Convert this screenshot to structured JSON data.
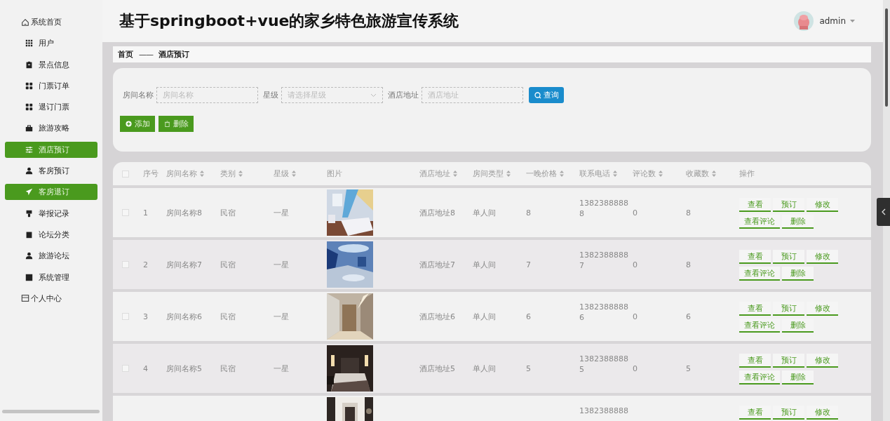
{
  "sidebar": {
    "items": [
      {
        "label": "系统首页",
        "kind": "top",
        "selected": false
      },
      {
        "label": "用户",
        "kind": "sub",
        "selected": false
      },
      {
        "label": "景点信息",
        "kind": "sub",
        "selected": false
      },
      {
        "label": "门票订单",
        "kind": "sub",
        "selected": false
      },
      {
        "label": "退订门票",
        "kind": "sub",
        "selected": false
      },
      {
        "label": "旅游攻略",
        "kind": "sub",
        "selected": false
      },
      {
        "label": "酒店预订",
        "kind": "sub",
        "selected": true
      },
      {
        "label": "客房预订",
        "kind": "sub",
        "selected": false
      },
      {
        "label": "客房退订",
        "kind": "sub",
        "selected": true
      },
      {
        "label": "举报记录",
        "kind": "sub",
        "selected": false
      },
      {
        "label": "论坛分类",
        "kind": "sub",
        "selected": false
      },
      {
        "label": "旅游论坛",
        "kind": "sub",
        "selected": false
      },
      {
        "label": "系统管理",
        "kind": "sub",
        "selected": false
      },
      {
        "label": "个人中心",
        "kind": "top",
        "selected": false
      }
    ]
  },
  "header": {
    "title": "基于springboot+vue的家乡特色旅游宣传系统",
    "user": "admin"
  },
  "breadcrumb": [
    "首页",
    "——",
    "酒店预订"
  ],
  "search": {
    "fields": [
      {
        "label": "房间名称",
        "placeholder": "房间名称",
        "kind": "input"
      },
      {
        "label": "星级",
        "placeholder": "请选择星级",
        "kind": "select"
      },
      {
        "label": "酒店地址",
        "placeholder": "酒店地址",
        "kind": "input"
      }
    ],
    "button": "查询"
  },
  "actions": [
    {
      "label": "添加",
      "kind": "add"
    },
    {
      "label": "删除",
      "kind": "delete"
    }
  ],
  "table": {
    "select_all": {
      "checked": false
    },
    "columns": [
      {
        "label": "序号",
        "sortable": false
      },
      {
        "label": "房间名称",
        "sortable": true
      },
      {
        "label": "类别",
        "sortable": true
      },
      {
        "label": "星级",
        "sortable": true
      },
      {
        "label": "图片",
        "sortable": false
      },
      {
        "label": "酒店地址",
        "sortable": true
      },
      {
        "label": "房间类型",
        "sortable": true
      },
      {
        "label": "一晚价格",
        "sortable": true
      },
      {
        "label": "联系电话",
        "sortable": true
      },
      {
        "label": "评论数",
        "sortable": true
      },
      {
        "label": "收藏数",
        "sortable": true
      },
      {
        "label": "操作",
        "sortable": false
      }
    ],
    "rows": [
      {
        "checked": false,
        "seq": "1",
        "name": "房间名称8",
        "category": "民宿",
        "star": "一星",
        "address": "酒店地址8",
        "room_type": "单人间",
        "price": "8",
        "phone": "13823888888",
        "comments": "0",
        "favorites": "8",
        "buttons": [
          "查看",
          "预订",
          "修改",
          "查看评论",
          "删除"
        ]
      },
      {
        "checked": false,
        "seq": "2",
        "name": "房间名称7",
        "category": "民宿",
        "star": "一星",
        "address": "酒店地址7",
        "room_type": "单人间",
        "price": "7",
        "phone": "13823888887",
        "comments": "0",
        "favorites": "8",
        "buttons": [
          "查看",
          "预订",
          "修改",
          "查看评论",
          "删除"
        ]
      },
      {
        "checked": false,
        "seq": "3",
        "name": "房间名称6",
        "category": "民宿",
        "star": "一星",
        "address": "酒店地址6",
        "room_type": "单人间",
        "price": "6",
        "phone": "13823888886",
        "comments": "0",
        "favorites": "6",
        "buttons": [
          "查看",
          "预订",
          "修改",
          "查看评论",
          "删除"
        ]
      },
      {
        "checked": false,
        "seq": "4",
        "name": "房间名称5",
        "category": "民宿",
        "star": "一星",
        "address": "酒店地址5",
        "room_type": "单人间",
        "price": "5",
        "phone": "13823888885",
        "comments": "0",
        "favorites": "5",
        "buttons": [
          "查看",
          "预订",
          "修改",
          "查看评论",
          "删除"
        ]
      },
      {
        "phone": "1382388888",
        "buttons": [
          "查看",
          "预订",
          "修改"
        ]
      }
    ]
  }
}
